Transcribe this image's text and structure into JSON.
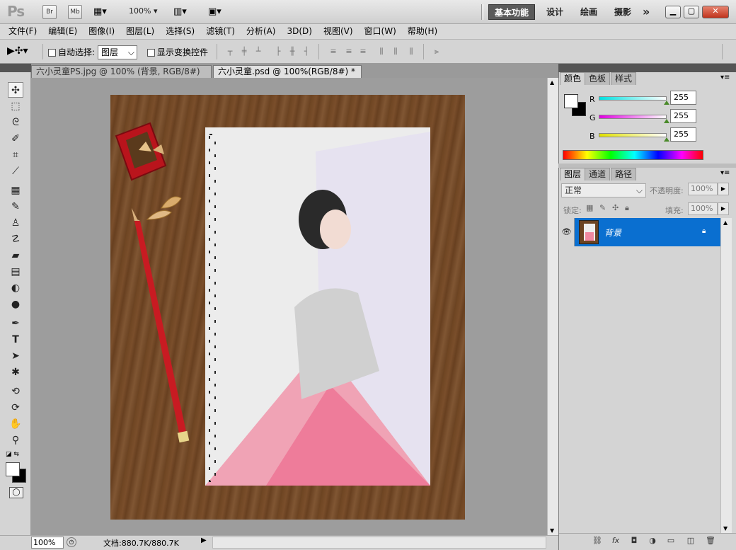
{
  "titlebar": {
    "logo": "Ps",
    "bridge": "Br",
    "minibridge": "Mb",
    "zoom": "100% ▾",
    "workspaces": [
      "基本功能",
      "设计",
      "绘画",
      "摄影"
    ],
    "more": "»"
  },
  "menu": [
    "文件(F)",
    "编辑(E)",
    "图像(I)",
    "图层(L)",
    "选择(S)",
    "滤镜(T)",
    "分析(A)",
    "3D(D)",
    "视图(V)",
    "窗口(W)",
    "帮助(H)"
  ],
  "options": {
    "auto_select_label": "自动选择:",
    "auto_select_value": "图层",
    "show_transform_label": "显示变换控件"
  },
  "tabs": [
    {
      "label": "六小灵童PS.jpg @ 100% (背景, RGB/8#) *"
    },
    {
      "label": "六小灵童.psd @ 100%(RGB/8#) *"
    }
  ],
  "color_panel": {
    "tabs": [
      "颜色",
      "色板",
      "样式"
    ],
    "channels": [
      {
        "label": "R",
        "value": "255",
        "color": "#00d0d0"
      },
      {
        "label": "G",
        "value": "255",
        "color": "#d000d0"
      },
      {
        "label": "B",
        "value": "255",
        "color": "#d0d000"
      }
    ]
  },
  "layers_panel": {
    "tabs": [
      "图层",
      "通道",
      "路径"
    ],
    "blend_mode": "正常",
    "opacity_label": "不透明度:",
    "opacity_value": "100%",
    "lock_label": "锁定:",
    "fill_label": "填充:",
    "fill_value": "100%",
    "layers": [
      {
        "name": "背景",
        "visible": true,
        "locked": true
      }
    ]
  },
  "status": {
    "zoom": "100%",
    "doc_info": "文档:880.7K/880.7K"
  }
}
